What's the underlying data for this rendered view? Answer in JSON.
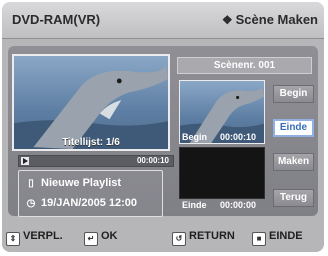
{
  "header": {
    "title": "DVD-RAM(VR)",
    "mode_icon": "diamond-icon",
    "mode": "Scène Maken"
  },
  "preview": {
    "label": "Titellijst: 1/6",
    "time": "00:00:10"
  },
  "info": {
    "playlist": "Nieuwe Playlist",
    "datetime": "19/JAN/2005 12:00"
  },
  "scene": {
    "title": "Scènenr. 001",
    "begin_label": "Begin",
    "begin_time": "00:00:10",
    "end_label": "Einde",
    "end_time": "00:00:00"
  },
  "buttons": {
    "begin": "Begin",
    "einde": "Einde",
    "maken": "Maken",
    "terug": "Terug"
  },
  "selected_button": "einde",
  "footer": {
    "move": "VERPL.",
    "ok": "OK",
    "return": "RETURN",
    "end": "EINDE"
  }
}
